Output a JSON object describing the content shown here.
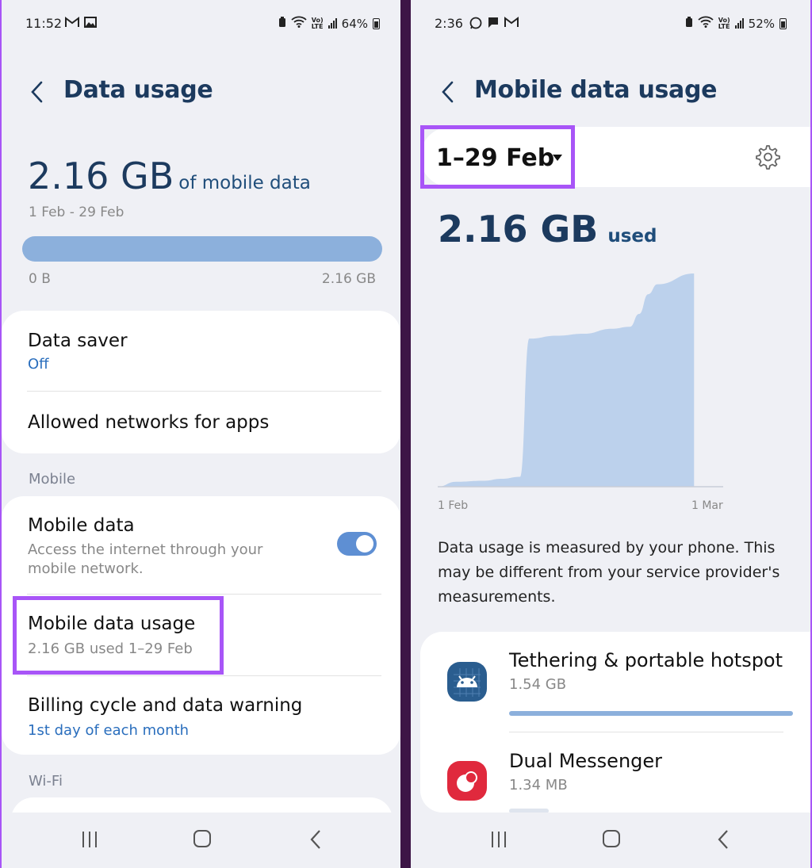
{
  "left": {
    "status": {
      "time": "11:52",
      "notif_icons": [
        "gmail-icon",
        "gallery-icon"
      ],
      "battery": "64%"
    },
    "header": {
      "title": "Data usage"
    },
    "summary": {
      "amount": "2.16 GB",
      "unit_text": "of mobile data",
      "range": "1 Feb - 29 Feb",
      "bar_min": "0 B",
      "bar_max": "2.16 GB",
      "bar_fill_fraction": 1.0
    },
    "card1": {
      "data_saver": {
        "title": "Data saver",
        "sub": "Off"
      },
      "allowed_networks": {
        "title": "Allowed networks for apps"
      }
    },
    "section_mobile": "Mobile",
    "card2": {
      "mobile_data": {
        "title": "Mobile data",
        "sub_line1": "Access the internet through your",
        "sub_line2": "mobile network.",
        "toggle_on": true
      },
      "mobile_data_usage": {
        "title": "Mobile data usage",
        "sub": "2.16 GB used 1–29 Feb"
      },
      "billing": {
        "title": "Billing cycle and data warning",
        "sub": "1st day of each month"
      }
    },
    "section_wifi": "Wi-Fi"
  },
  "right": {
    "status": {
      "time": "2:36",
      "notif_icons": [
        "whatsapp-icon",
        "messages-icon",
        "gmail-icon"
      ],
      "battery": "52%"
    },
    "header": {
      "title": "Mobile data usage"
    },
    "period": {
      "label": "1–29 Feb"
    },
    "used": {
      "amount": "2.16 GB",
      "unit_text": "used"
    },
    "chart_data": {
      "type": "area",
      "x": [
        "1 Feb",
        "3 Feb",
        "6 Feb",
        "8 Feb",
        "10 Feb",
        "11 Feb",
        "14 Feb",
        "17 Feb",
        "20 Feb",
        "22 Feb",
        "23 Feb",
        "24 Feb",
        "25 Feb",
        "29 Feb"
      ],
      "values": [
        0.0,
        0.05,
        0.06,
        0.08,
        0.1,
        1.5,
        1.53,
        1.55,
        1.6,
        1.62,
        1.75,
        1.95,
        2.05,
        2.16
      ],
      "title": "",
      "xlabel": "",
      "ylabel": "",
      "x_tick_labels": [
        "1 Feb",
        "1 Mar"
      ],
      "ylim": [
        0,
        2.2
      ],
      "grid": false,
      "color": "#bcd1ec"
    },
    "note": "Data usage is measured by your phone. This may be different from your service provider's measurements.",
    "apps": [
      {
        "name": "Tethering & portable hotspot",
        "usage": "1.54 GB",
        "fraction": 1.0
      },
      {
        "name": "Dual Messenger",
        "usage": "1.34 MB",
        "fraction": 0.001
      }
    ]
  },
  "colors": {
    "accent": "#1c3a5e",
    "link": "#2a6ebd",
    "bar": "#8cb0dc",
    "highlight": "#a855f7",
    "toggle": "#5e8fd3"
  }
}
